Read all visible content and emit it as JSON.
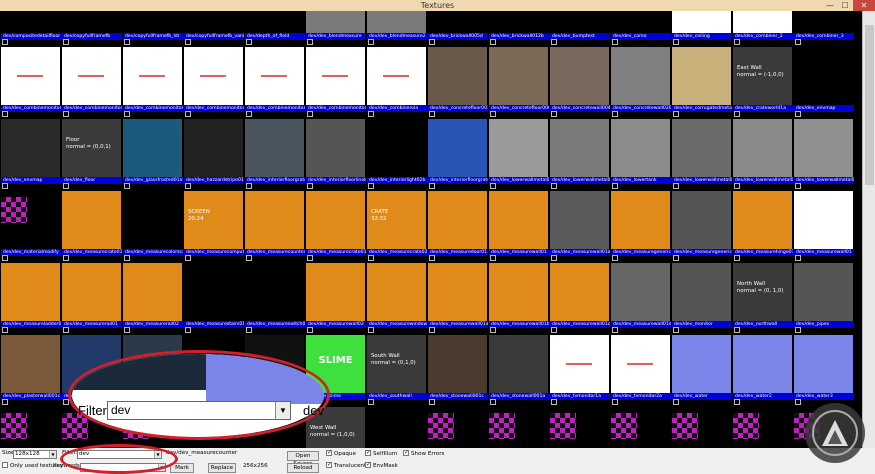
{
  "window": {
    "title": "Textures",
    "min": "—",
    "max": "☐",
    "close": "✕"
  },
  "zoom_overlay": {
    "filter_label": "Filter:",
    "filter_value": "dev",
    "trailing": "dev"
  },
  "bottom": {
    "size_label": "Size:",
    "size_value": "128x128",
    "filter_label": "Filter:",
    "filter_value": "dev",
    "selected": "dev/dev_measurecounter",
    "only_used_label": "Only used textures",
    "keywords_label": "Keywords:",
    "mark_label": "Mark",
    "replace_label": "Replace",
    "dims": "256x256",
    "open_source_label": "Open Source",
    "reload_label": "Reload",
    "opaque_label": "Opaque",
    "translucent_label": "Translucent",
    "selfillum_label": "SelfIllum",
    "envmask_label": "EnvMask",
    "show_errors_label": "Show Errors"
  },
  "tiles": [
    {
      "label": "dev/compositedetailfloor",
      "bg": "#000"
    },
    {
      "label": "dev/copyfullframefb",
      "bg": "#000"
    },
    {
      "label": "dev/copyfullframefb_ldr",
      "bg": "#000"
    },
    {
      "label": "dev/copyfullframefb_vanilla",
      "bg": "#000"
    },
    {
      "label": "dev/depth_of_field",
      "bg": "#000"
    },
    {
      "label": "dev/dev_blendmeasure",
      "bg": "#7a7a7a"
    },
    {
      "label": "dev/dev_blendmeasure2",
      "bg": "#7a7a7a"
    },
    {
      "label": "dev/dev_brickwall005d",
      "bg": "#000"
    },
    {
      "label": "dev/dev_brickwall012b",
      "bg": "#000"
    },
    {
      "label": "dev/dev_bumptest",
      "bg": "#000"
    },
    {
      "label": "dev/dev_camo",
      "bg": "#000"
    },
    {
      "label": "dev/dev_ceiling",
      "bg": "#fff"
    },
    {
      "label": "dev/dev_combiner_2",
      "bg": "#fff"
    },
    {
      "label": "dev/dev_combiner_3",
      "bg": "#000"
    },
    {
      "label": "dev/dev_combinemonitor_1",
      "bg": "#fff",
      "redtxt": true
    },
    {
      "label": "dev/dev_combinemonitor_2",
      "bg": "#fff",
      "redtxt": true
    },
    {
      "label": "dev/dev_combinemonitor_3",
      "bg": "#fff",
      "redtxt": true
    },
    {
      "label": "dev/dev_combinemonitor_4",
      "bg": "#fff",
      "redtxt": true
    },
    {
      "label": "dev/dev_combinemonitor_5",
      "bg": "#fff",
      "redtxt": true
    },
    {
      "label": "dev/dev_combinemonitor_6",
      "bg": "#fff",
      "redtxt": true
    },
    {
      "label": "dev/dev_combinerola",
      "bg": "#fff",
      "redtxt": true
    },
    {
      "label": "dev/dev_concretefloor001a",
      "bg": "#6a5a4a"
    },
    {
      "label": "dev/dev_concretefloor006a",
      "bg": "#7b6a56"
    },
    {
      "label": "dev/dev_concretewall004a",
      "bg": "#7a6a5e"
    },
    {
      "label": "dev/dev_concretewall020a",
      "bg": "#808080"
    },
    {
      "label": "dev/dev_corrugatedmetal",
      "bg": "#c9b07a"
    },
    {
      "label": "dev/dev_crateworld1a",
      "bg": "#3a3a3a",
      "text": "East Wall\nnormal = (-1,0,0)"
    },
    {
      "label": "dev/dev_envmap",
      "bg": "#000"
    },
    {
      "label": "dev/dev_envmap",
      "bg": "#2a2a2a"
    },
    {
      "label": "dev/dev_floor",
      "bg": "#3a3a3a",
      "text": "Floor\nnormal = (0,0,1)"
    },
    {
      "label": "dev/dev_glassfrosted01a",
      "bg": "#1b5a7a"
    },
    {
      "label": "dev/dev_hazzardstripe01a",
      "bg": "#222"
    },
    {
      "label": "dev/dev_interiorfloorgrate",
      "bg": "#4a5560"
    },
    {
      "label": "dev/dev_interiorfloorlinoleum",
      "bg": "#555"
    },
    {
      "label": "dev/dev_interiorlight02b",
      "bg": "#000"
    },
    {
      "label": "dev/dev_interiorfloorgrate01d",
      "bg": "#2a55b5"
    },
    {
      "label": "dev/dev_lowerwallmetal01",
      "bg": "#9a9a9a"
    },
    {
      "label": "dev/dev_lowerwallmetal01a",
      "bg": "#7a7a7a"
    },
    {
      "label": "dev/dev_lowertank",
      "bg": "#8c8c8c"
    },
    {
      "label": "dev/dev_lowerwallmetal01b",
      "bg": "#6b6b6b"
    },
    {
      "label": "dev/dev_lowerwallmetal01c",
      "bg": "#8a8a8a"
    },
    {
      "label": "dev/dev_lowerwallmetal01d",
      "bg": "#909090"
    },
    {
      "label": "dev/dev_materialmodify",
      "bg": "#000",
      "checker": true
    },
    {
      "label": "dev/dev_measurecrate01",
      "bg": "#e08a1a"
    },
    {
      "label": "dev/dev_measurecolorscale01",
      "bg": "#000"
    },
    {
      "label": "dev/dev_measurecomputer01",
      "bg": "#e08a1a",
      "text": "SCREEN\n20:24"
    },
    {
      "label": "dev/dev_measurecounter",
      "bg": "#e08a1a"
    },
    {
      "label": "dev/dev_measurecrate01",
      "bg": "#e08a1a"
    },
    {
      "label": "dev/dev_measurecrate02",
      "bg": "#e08a1a",
      "text": "CRATE\n32:32"
    },
    {
      "label": "dev/dev_measuredoor01",
      "bg": "#e08a1a"
    },
    {
      "label": "dev/dev_measurewall01",
      "bg": "#e08a1a"
    },
    {
      "label": "dev/dev_measurewall01a",
      "bg": "#5a5a5a"
    },
    {
      "label": "dev/dev_measuregeneric01",
      "bg": "#e08a1a"
    },
    {
      "label": "dev/dev_measuregeneric01b",
      "bg": "#555"
    },
    {
      "label": "dev/dev_measurehinge01",
      "bg": "#e08a1a"
    },
    {
      "label": "dev/dev_measurewall01",
      "bg": "#fff"
    },
    {
      "label": "dev/dev_measureladder01",
      "bg": "#e08a1a"
    },
    {
      "label": "dev/dev_measurerail01",
      "bg": "#e08a1a"
    },
    {
      "label": "dev/dev_measurerail02",
      "bg": "#e08a1a"
    },
    {
      "label": "dev/dev_measurestairs01a",
      "bg": "#000"
    },
    {
      "label": "dev/dev_measureswitch01",
      "bg": "#000"
    },
    {
      "label": "dev/dev_measurewall02",
      "bg": "#e08a1a"
    },
    {
      "label": "dev/dev_measurewindow02",
      "bg": "#e08a1a"
    },
    {
      "label": "dev/dev_measurewall01a",
      "bg": "#e08a1a"
    },
    {
      "label": "dev/dev_measurewall01b",
      "bg": "#e08a1a"
    },
    {
      "label": "dev/dev_measurewall01c",
      "bg": "#e08a1a"
    },
    {
      "label": "dev/dev_measurewall01d",
      "bg": "#666"
    },
    {
      "label": "dev/dev_monitor",
      "bg": "#555"
    },
    {
      "label": "dev/dev_northwall",
      "bg": "#3a3a3a",
      "text": "North Wall\nnormal = (0, 1,0)"
    },
    {
      "label": "dev/dev_pipes",
      "bg": "#555"
    },
    {
      "label": "dev/dev_plasterwall001c",
      "bg": "#7a5a3a"
    },
    {
      "label": "dev/dev_reflection",
      "bg": "#223a6a"
    },
    {
      "label": "dev/dev_reflection2",
      "bg": "#2a3a4a"
    },
    {
      "label": "dev/dev_scrollwater",
      "bg": "#000"
    },
    {
      "label": "dev/dev_signflammable01a",
      "bg": "#111"
    },
    {
      "label": "dev/dev_slime",
      "bg": "#3ee03e",
      "text": "SLIME"
    },
    {
      "label": "dev/dev_southwall",
      "bg": "#3a3a3a",
      "text": "South Wall\nnormal = (0,1,0)"
    },
    {
      "label": "dev/dev_stonewall001c",
      "bg": "#4a3a30"
    },
    {
      "label": "dev/dev_stonewall001a",
      "bg": "#3a3a3a"
    },
    {
      "label": "dev/dev_tvmonitor1a",
      "bg": "#fff",
      "redtxt": true
    },
    {
      "label": "dev/dev_tvmonitor2a",
      "bg": "#fff",
      "redtxt": true
    },
    {
      "label": "dev/dev_water",
      "bg": "#7b84e8"
    },
    {
      "label": "dev/dev_water2",
      "bg": "#7b84e8"
    },
    {
      "label": "dev/dev_water3",
      "bg": "#7b84e8"
    },
    {
      "label": "",
      "bg": "#000",
      "checker": true
    },
    {
      "label": "",
      "bg": "#000",
      "checker": true
    },
    {
      "label": "",
      "bg": "#000",
      "checker": true
    },
    {
      "label": "",
      "bg": "#000"
    },
    {
      "label": "",
      "bg": "#000"
    },
    {
      "label": "",
      "bg": "#3a3a3a",
      "text": "West Wall\nnormal = (1,0,0)"
    },
    {
      "label": "",
      "bg": "#000"
    },
    {
      "label": "",
      "bg": "#000",
      "checker": true
    },
    {
      "label": "",
      "bg": "#000",
      "checker": true
    },
    {
      "label": "",
      "bg": "#000",
      "checker": true
    },
    {
      "label": "",
      "bg": "#000",
      "checker": true
    },
    {
      "label": "",
      "bg": "#000",
      "checker": true
    },
    {
      "label": "",
      "bg": "#000",
      "checker": true
    },
    {
      "label": "",
      "bg": "#000",
      "checker": true
    }
  ]
}
